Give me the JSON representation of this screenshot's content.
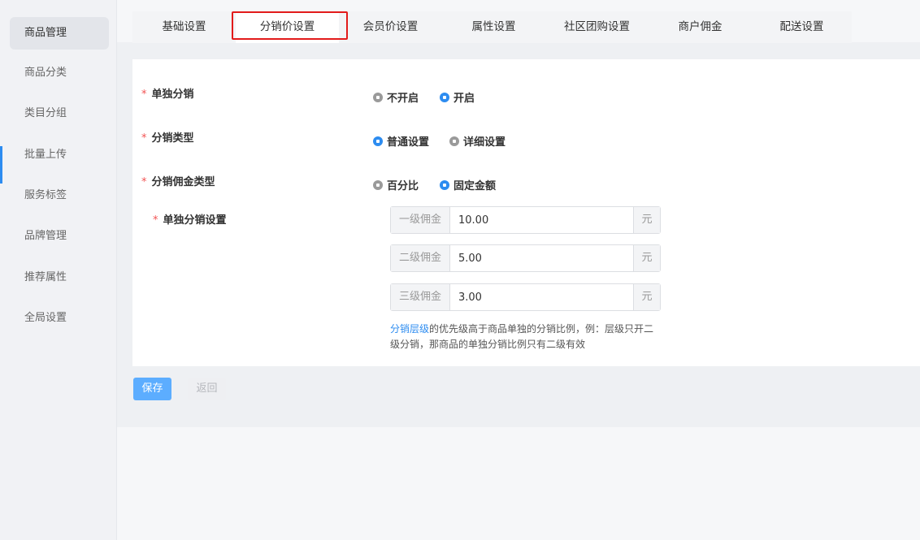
{
  "sidebar": {
    "items": [
      {
        "label": "商品管理",
        "active": true
      },
      {
        "label": "商品分类"
      },
      {
        "label": "类目分组"
      },
      {
        "label": "批量上传"
      },
      {
        "label": "服务标签"
      },
      {
        "label": "品牌管理"
      },
      {
        "label": "推荐属性"
      },
      {
        "label": "全局设置"
      }
    ]
  },
  "tabs": [
    {
      "label": "基础设置"
    },
    {
      "label": "分销价设置",
      "active": true
    },
    {
      "label": "会员价设置"
    },
    {
      "label": "属性设置"
    },
    {
      "label": "社区团购设置"
    },
    {
      "label": "商户佣金"
    },
    {
      "label": "配送设置"
    }
  ],
  "form": {
    "required_mark": "*",
    "single_distribution": {
      "label": "单独分销",
      "options": [
        "不开启",
        "开启"
      ],
      "selected": "开启"
    },
    "distribution_type": {
      "label": "分销类型",
      "options": [
        "普通设置",
        "详细设置"
      ],
      "selected": "普通设置"
    },
    "commission_type": {
      "label": "分销佣金类型",
      "options": [
        "百分比",
        "固定金额"
      ],
      "selected": "固定金额"
    },
    "single_settings": {
      "label": "单独分销设置",
      "rows": [
        {
          "prefix": "一级佣金",
          "value": "10.00",
          "suffix": "元"
        },
        {
          "prefix": "二级佣金",
          "value": "5.00",
          "suffix": "元"
        },
        {
          "prefix": "三级佣金",
          "value": "3.00",
          "suffix": "元"
        }
      ]
    },
    "hint": {
      "link": "分销层级",
      "text": "的优先级高于商品单独的分销比例，例：层级只开二级分销，那商品的单独分销比例只有二级有效"
    }
  },
  "buttons": {
    "save": "保存",
    "back": "返回"
  },
  "colors": {
    "accent": "#2d8cf0",
    "highlight_box": "#e21b1b",
    "required": "#f25353"
  }
}
